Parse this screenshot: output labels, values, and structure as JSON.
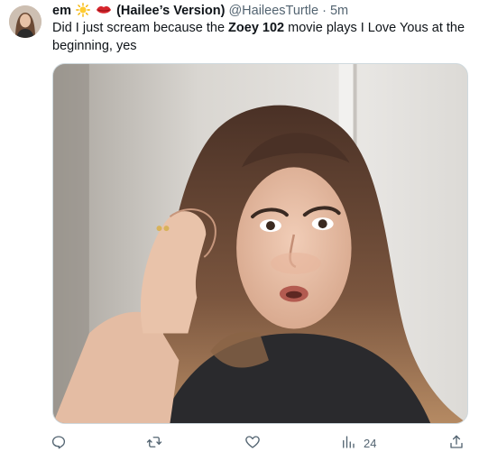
{
  "tweet": {
    "display_name": "em",
    "display_name_suffix": "(Hailee’s Version)",
    "handle": "@HaileesTurtle",
    "separator": "·",
    "time": "5m",
    "text_before": "Did I just scream because the ",
    "text_bold": "Zoey 102",
    "text_after": " movie plays I Love Yous at the beginning, yes",
    "views": "24"
  },
  "icons": {
    "reply": "reply-icon",
    "retweet": "retweet-icon",
    "like": "like-icon",
    "views": "views-icon",
    "share": "share-icon",
    "sun": "sun-emoji",
    "lips": "lips-emoji"
  },
  "colors": {
    "text": "#0f1419",
    "muted": "#536471",
    "border": "#cfd9de"
  }
}
